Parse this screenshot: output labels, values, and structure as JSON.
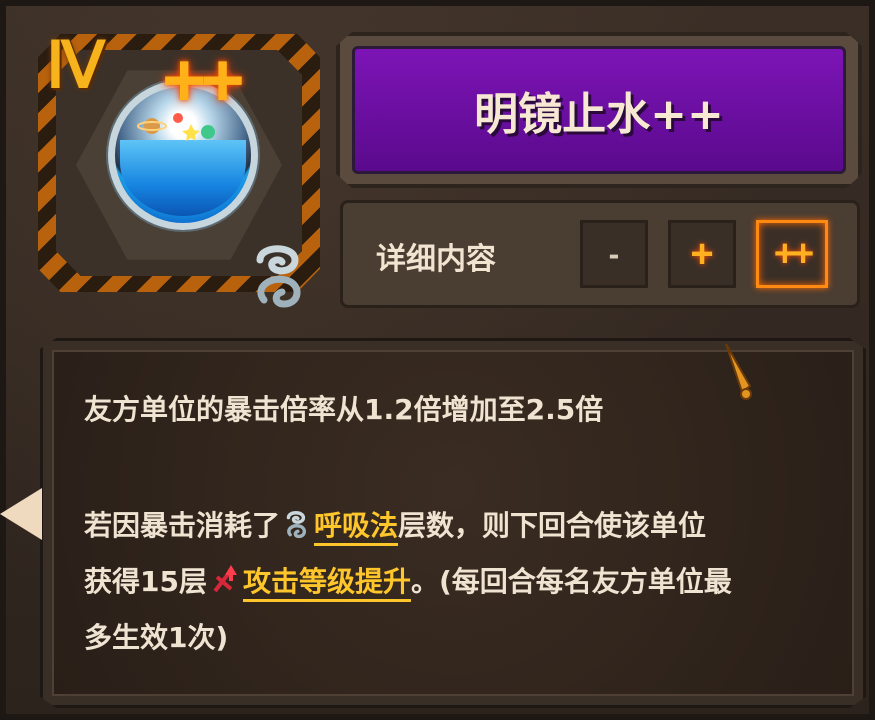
{
  "card": {
    "tier": "Ⅳ",
    "upgrade_mark": "++",
    "icon": "crystal-ball-icon",
    "badge_icon": "breath-swirl-icon"
  },
  "title": "明镜止水++",
  "details": {
    "label": "详细内容",
    "levels": [
      "-",
      "+",
      "++"
    ],
    "selected": "++"
  },
  "description": {
    "line1": "友方单位的暴击倍率从1.2倍增加至2.5倍",
    "line2_pre": "若因暴击消耗了",
    "line2_link": "呼吸法",
    "line2_post": "层数，则下回合使该单位",
    "line3_pre": "获得15层",
    "line3_link": "攻击等级提升",
    "line3_post": "。(每回合每名友方单位最",
    "line4": "多生效1次)"
  },
  "colors": {
    "title_bg": "#6e10a8",
    "accent": "#ffb021",
    "link": "#ffc62b"
  }
}
